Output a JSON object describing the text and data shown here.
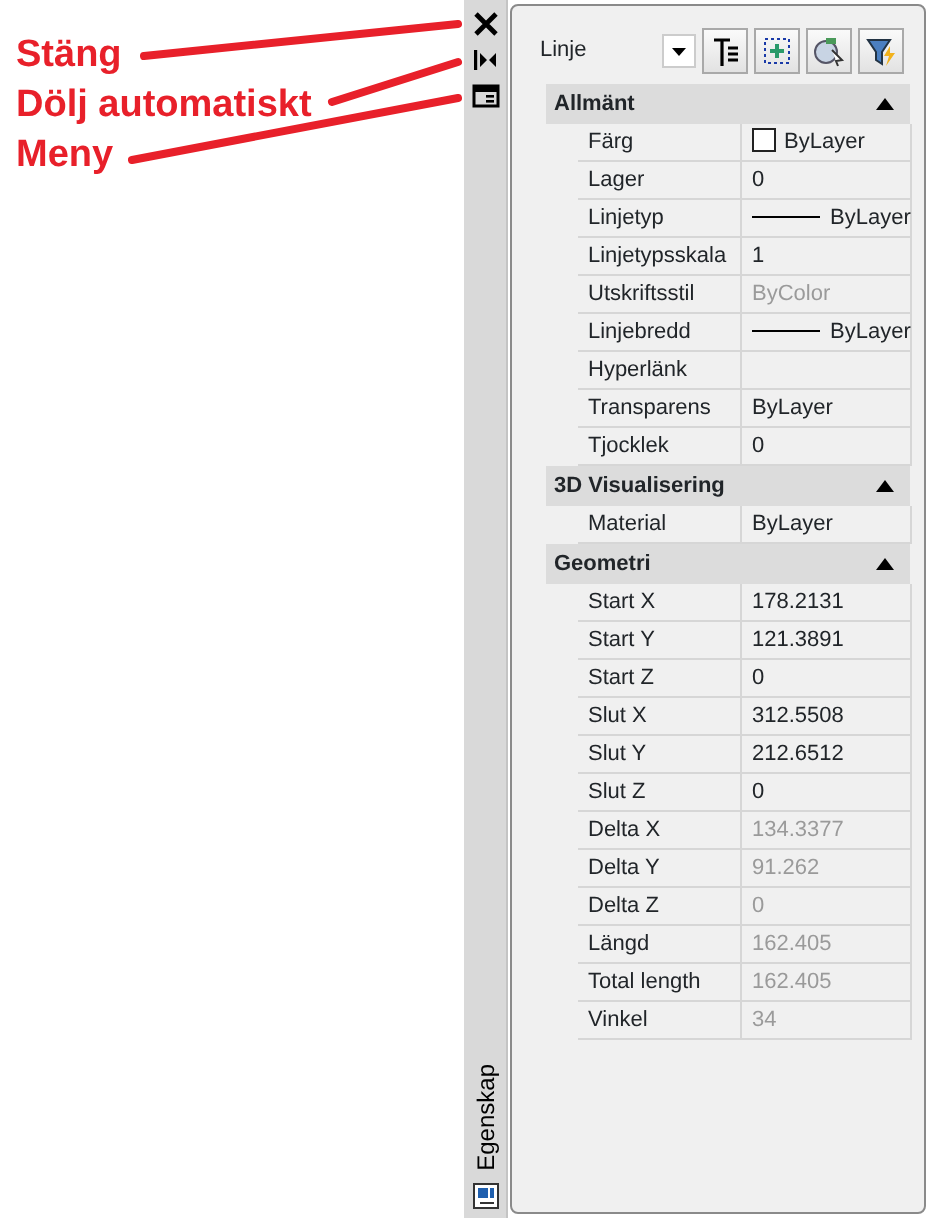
{
  "annotations": [
    {
      "label": "Stäng"
    },
    {
      "label": "Dölj automatiskt"
    },
    {
      "label": "Meny"
    }
  ],
  "side_strip": {
    "title": "Egenskap"
  },
  "toolbar": {
    "object_type": "Linje"
  },
  "sections": [
    {
      "title": "Allmänt",
      "expanded": true,
      "rows": [
        {
          "label": "Färg",
          "value": "ByLayer",
          "kind": "color",
          "disabled": false
        },
        {
          "label": "Lager",
          "value": "0",
          "kind": "text",
          "disabled": false
        },
        {
          "label": "Linjetyp",
          "value": "ByLayer",
          "kind": "linetype",
          "disabled": false
        },
        {
          "label": "Linjetypsskala",
          "value": "1",
          "kind": "text",
          "disabled": false
        },
        {
          "label": "Utskriftsstil",
          "value": "ByColor",
          "kind": "text",
          "disabled": true
        },
        {
          "label": "Linjebredd",
          "value": "ByLayer",
          "kind": "linetype",
          "disabled": false
        },
        {
          "label": "Hyperlänk",
          "disabled": false
        },
        {
          "label": "Transparens",
          "value": "ByLayer",
          "kind": "text",
          "disabled": false
        },
        {
          "label": "Tjocklek",
          "value": "0",
          "kind": "text",
          "disabled": false
        }
      ]
    },
    {
      "title": "3D Visualisering",
      "expanded": true,
      "rows": [
        {
          "label": "Material",
          "value": "ByLayer",
          "kind": "text",
          "disabled": false
        }
      ]
    },
    {
      "title": "Geometri",
      "expanded": true,
      "rows": [
        {
          "label": "Start X",
          "value": "178.2131",
          "kind": "text",
          "disabled": false
        },
        {
          "label": "Start Y",
          "value": "121.3891",
          "kind": "text",
          "disabled": false
        },
        {
          "label": "Start Z",
          "value": "0",
          "kind": "text",
          "disabled": false
        },
        {
          "label": "Slut X",
          "value": "312.5508",
          "kind": "text",
          "disabled": false
        },
        {
          "label": "Slut Y",
          "value": "212.6512",
          "kind": "text",
          "disabled": false
        },
        {
          "label": "Slut Z",
          "value": "0",
          "kind": "text",
          "disabled": false
        },
        {
          "label": "Delta X",
          "value": "134.3377",
          "kind": "text",
          "disabled": true
        },
        {
          "label": "Delta Y",
          "value": "91.262",
          "kind": "text",
          "disabled": true
        },
        {
          "label": "Delta Z",
          "value": "0",
          "kind": "text",
          "disabled": true
        },
        {
          "label": "Längd",
          "value": "162.405",
          "kind": "text",
          "disabled": true
        },
        {
          "label": "Total length",
          "value": "162.405",
          "kind": "text",
          "disabled": true
        },
        {
          "label": "Vinkel",
          "value": "34",
          "kind": "text",
          "disabled": true
        }
      ]
    }
  ]
}
